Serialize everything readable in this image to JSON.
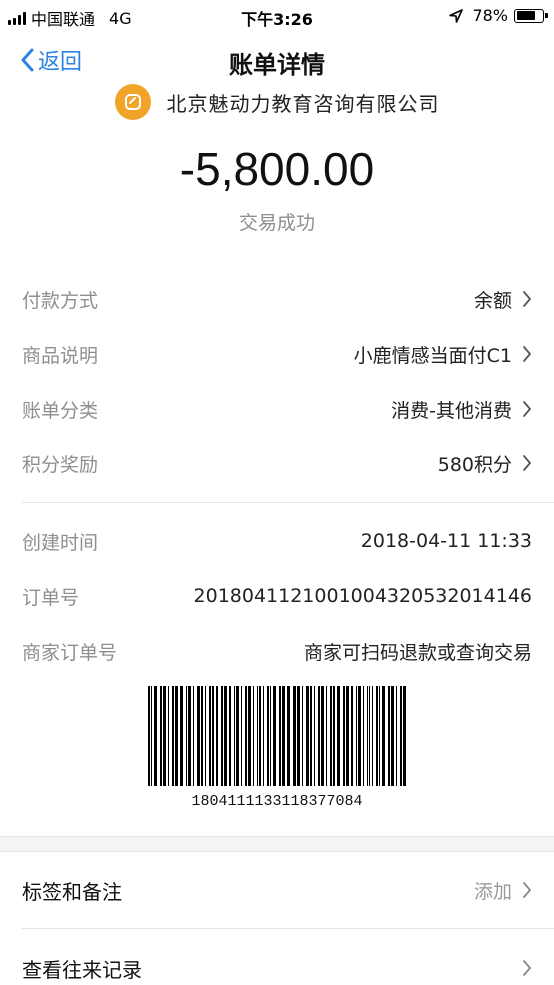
{
  "status_bar": {
    "carrier": "中国联通",
    "network": "4G",
    "time": "下午3:26",
    "battery_text": "78%",
    "battery_level": 0.78,
    "icons": [
      "signal-icon",
      "location-arrow-icon",
      "battery-icon"
    ]
  },
  "nav": {
    "back_label": "返回",
    "title": "账单详情"
  },
  "header": {
    "merchant_name": "北京魅动力教育咨询有限公司",
    "amount": "-5,800.00",
    "status": "交易成功"
  },
  "details": [
    {
      "label": "付款方式",
      "value": "余额",
      "chevron": true
    },
    {
      "label": "商品说明",
      "value": "小鹿情感当面付C1",
      "chevron": true
    },
    {
      "label": "账单分类",
      "value": "消费-其他消费",
      "chevron": true
    },
    {
      "label": "积分奖励",
      "value": "580积分",
      "chevron": true
    }
  ],
  "order_info": [
    {
      "label": "创建时间",
      "value": "2018-04-11 11:33"
    },
    {
      "label": "订单号",
      "value": "20180411210010043205320141​46"
    },
    {
      "label": "商家订单号",
      "value": "商家可扫码退款或查询交易"
    }
  ],
  "barcode": {
    "number": "1804111133118377084"
  },
  "actions": [
    {
      "label": "标签和备注",
      "value": "添加"
    },
    {
      "label": "查看往来记录",
      "value": ""
    }
  ],
  "colors": {
    "accent": "#2a83e6",
    "logo": "#f0a52a",
    "label_gray": "#8f8f8f"
  }
}
